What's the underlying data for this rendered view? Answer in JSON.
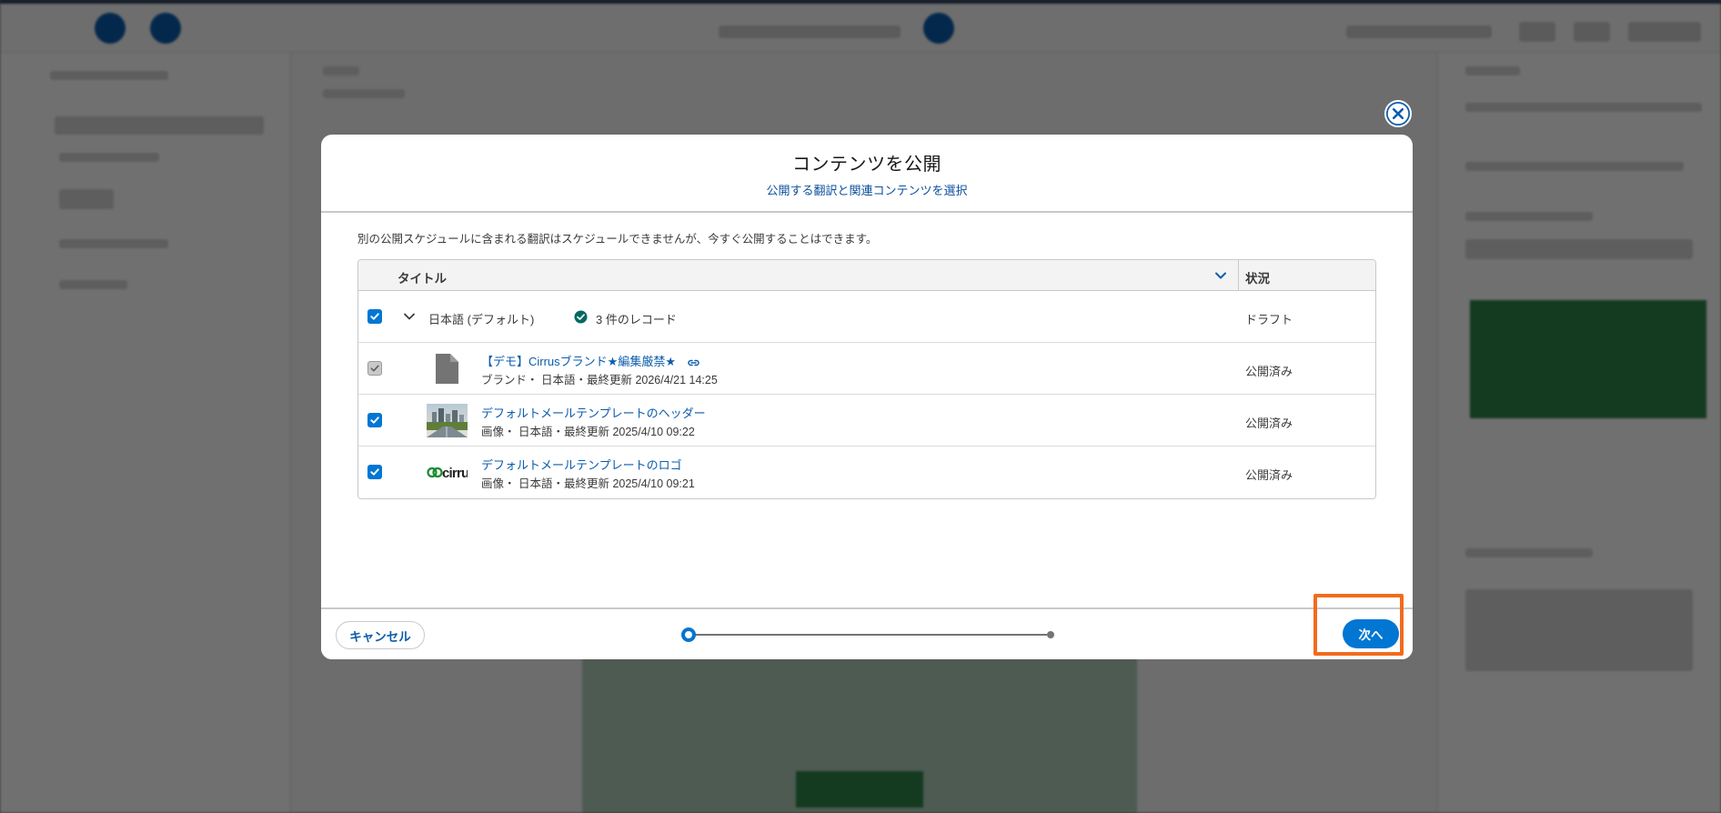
{
  "modal": {
    "title": "コンテンツを公開",
    "subtitle": "公開する翻訳と関連コンテンツを選択",
    "notice": "別の公開スケジュールに含まれる翻訳はスケジュールできませんが、今すぐ公開することはできます。",
    "close_icon": "close-icon"
  },
  "table": {
    "columns": {
      "title": "タイトル",
      "status": "状況"
    },
    "group": {
      "label": "日本語 (デフォルト)",
      "record_count": "3 件のレコード",
      "status": "ドラフト",
      "checked": true
    },
    "rows": [
      {
        "title": "【デモ】Cirrusブランド★編集厳禁★",
        "meta": "ブランド・ 日本語・最終更新 2026/4/21 14:25",
        "status": "公開済み",
        "thumb_icon": "document-icon",
        "checked": true,
        "disabled": true,
        "has_link_icon": true
      },
      {
        "title": "デフォルトメールテンプレートのヘッダー",
        "meta": "画像・ 日本語・最終更新 2025/4/10 09:22",
        "status": "公開済み",
        "thumb_icon": "city-image-thumbnail",
        "checked": true
      },
      {
        "title": "デフォルトメールテンプレートのロゴ",
        "meta": "画像・ 日本語・最終更新 2025/4/10 09:21",
        "status": "公開済み",
        "thumb_icon": "cirrus-logo-thumbnail",
        "logo_text": "cirrus",
        "checked": true
      }
    ]
  },
  "footer": {
    "cancel_label": "キャンセル",
    "next_label": "次へ",
    "progress": {
      "current_step": 1,
      "total_steps": 2
    }
  },
  "colors": {
    "brand_blue": "#0176d3",
    "link_blue": "#0b5cab",
    "highlight_orange": "#f26b1d",
    "success_green": "#2e844a"
  }
}
